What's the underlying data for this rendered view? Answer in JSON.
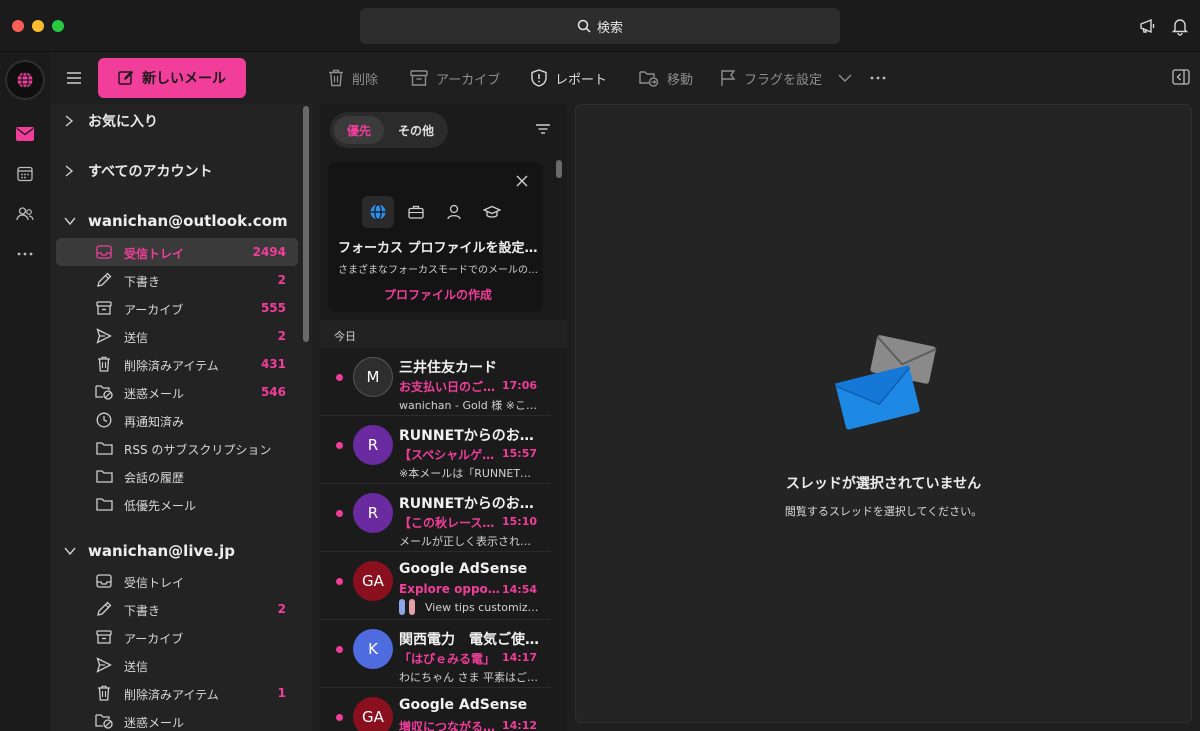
{
  "titlebar": {
    "search_label": "検索"
  },
  "toolbar": {
    "new_mail_label": "新しいメール",
    "delete_label": "削除",
    "archive_label": "アーカイブ",
    "report_label": "レポート",
    "move_label": "移動",
    "flag_label": "フラグを設定"
  },
  "folders": {
    "favorites_label": "お気に入り",
    "all_accounts_label": "すべてのアカウント",
    "accounts": [
      {
        "email": "wanichan@outlook.com",
        "items": [
          {
            "label": "受信トレイ",
            "count": "2494",
            "icon": "inbox-icon"
          },
          {
            "label": "下書き",
            "count": "2",
            "icon": "pencil-icon"
          },
          {
            "label": "アーカイブ",
            "count": "555",
            "icon": "archive-icon"
          },
          {
            "label": "送信",
            "count": "2",
            "icon": "send-icon"
          },
          {
            "label": "削除済みアイテム",
            "count": "431",
            "icon": "trash-icon"
          },
          {
            "label": "迷惑メール",
            "count": "546",
            "icon": "junk-folder-icon"
          },
          {
            "label": "再通知済み",
            "count": "",
            "icon": "clock-icon"
          },
          {
            "label": "RSS のサブスクリプション",
            "count": "",
            "icon": "folder-icon"
          },
          {
            "label": "会話の履歴",
            "count": "",
            "icon": "folder-icon"
          },
          {
            "label": "低優先メール",
            "count": "",
            "icon": "folder-icon"
          }
        ]
      },
      {
        "email": "wanichan@live.jp",
        "items": [
          {
            "label": "受信トレイ",
            "count": "",
            "icon": "inbox-icon"
          },
          {
            "label": "下書き",
            "count": "2",
            "icon": "pencil-icon"
          },
          {
            "label": "アーカイブ",
            "count": "",
            "icon": "archive-icon"
          },
          {
            "label": "送信",
            "count": "",
            "icon": "send-icon"
          },
          {
            "label": "削除済みアイテム",
            "count": "1",
            "icon": "trash-icon"
          },
          {
            "label": "迷惑メール",
            "count": "",
            "icon": "junk-folder-icon"
          }
        ]
      }
    ]
  },
  "message_list": {
    "tab_focused": "優先",
    "tab_other": "その他",
    "promo": {
      "title": "フォーカス プロファイルを設定する",
      "subtitle": "さまざまなフォーカスモードでのメールの表示",
      "link": "プロファイルの作成"
    },
    "section_today": "今日",
    "messages": [
      {
        "avatar": "M",
        "avatar_color": "#2e2e2e",
        "sender": "三井住友カード",
        "subject": "お支払い日のご案内",
        "time": "17:06",
        "preview": "wanichan - Gold 様 ※このメール"
      },
      {
        "avatar": "R",
        "avatar_color": "#6a2aa0",
        "sender": "RUNNETからのお知らせ",
        "subject": "【スペシャルゲスト】",
        "time": "15:57",
        "preview": "※本メールは「RUNNET」会員"
      },
      {
        "avatar": "R",
        "avatar_color": "#6a2aa0",
        "sender": "RUNNETからのお知らせ",
        "subject": "【この秋レース情報】",
        "time": "15:10",
        "preview": "メールが正しく表示されない場合"
      },
      {
        "avatar": "GA",
        "avatar_color": "#8a1020",
        "sender": "Google AdSense",
        "subject": "Explore opportunities",
        "time": "14:54",
        "preview": "View tips customized"
      },
      {
        "avatar": "K",
        "avatar_color": "#4f6be0",
        "sender": "関西電力　電気ご使用量",
        "subject": "「はぴｅみる電」",
        "time": "14:17",
        "preview": "わにちゃん さま 平素はご愛顧"
      },
      {
        "avatar": "GA",
        "avatar_color": "#8a1020",
        "sender": "Google AdSense",
        "subject": "増収につながるヒント",
        "time": "14:12",
        "preview": ""
      }
    ]
  },
  "reading_pane": {
    "empty_title": "スレッドが選択されていません",
    "empty_subtitle": "閲覧するスレッドを選択してください。"
  },
  "colors": {
    "accent": "#f03e9a",
    "background": "#1f1f1f"
  }
}
